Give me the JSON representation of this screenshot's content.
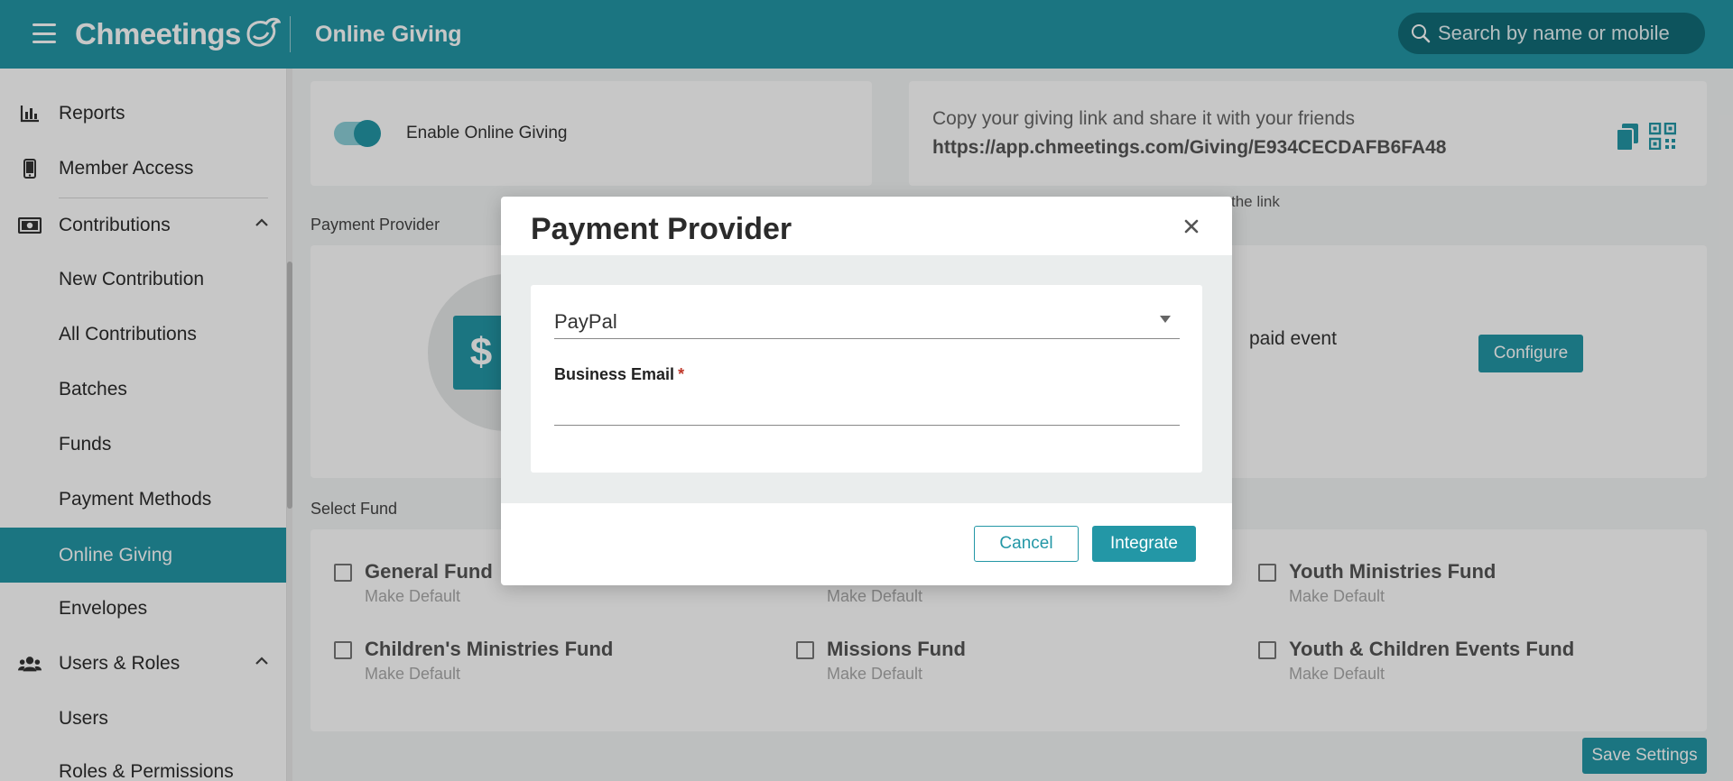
{
  "header": {
    "brand": "Chmeetings",
    "page_title": "Online Giving",
    "search_placeholder": "Search by name or mobile"
  },
  "sidebar": {
    "items": [
      {
        "label": "Reports",
        "icon": "bar-chart-icon"
      },
      {
        "label": "Member Access",
        "icon": "mobile-phone-icon"
      },
      {
        "label": "Contributions",
        "icon": "money-icon",
        "expanded": true
      },
      {
        "label": "New Contribution"
      },
      {
        "label": "All Contributions"
      },
      {
        "label": "Batches"
      },
      {
        "label": "Funds"
      },
      {
        "label": "Payment Methods"
      },
      {
        "label": "Online Giving",
        "active": true
      },
      {
        "label": "Envelopes"
      },
      {
        "label": "Users & Roles",
        "icon": "users-icon",
        "expanded": true
      },
      {
        "label": "Users"
      },
      {
        "label": "Roles & Permissions"
      }
    ]
  },
  "main": {
    "toggle_label": "Enable Online Giving",
    "toggle_on": true,
    "link_caption": "Copy your giving link and share it with your friends",
    "link_url": "https://app.chmeetings.com/Giving/E934CECDAFB6FA48",
    "link_note": "the link",
    "payment_provider_label": "Payment Provider",
    "provider_text": "paid event",
    "configure_label": "Configure",
    "select_fund_label": "Select Fund",
    "funds": [
      {
        "name": "General Fund",
        "sub": "Make Default"
      },
      {
        "name": "",
        "sub": "Make Default"
      },
      {
        "name": "Youth Ministries Fund",
        "sub": "Make Default"
      },
      {
        "name": "Children's Ministries Fund",
        "sub": "Make Default"
      },
      {
        "name": "Missions Fund",
        "sub": "Make Default"
      },
      {
        "name": "Youth & Children Events Fund",
        "sub": "Make Default"
      }
    ],
    "save_label": "Save Settings"
  },
  "modal": {
    "title": "Payment Provider",
    "provider_selected": "PayPal",
    "email_label": "Business Email",
    "required_mark": "*",
    "cancel_label": "Cancel",
    "integrate_label": "Integrate"
  },
  "colors": {
    "primary": "#2397a6",
    "primary_dark": "#116c78"
  }
}
